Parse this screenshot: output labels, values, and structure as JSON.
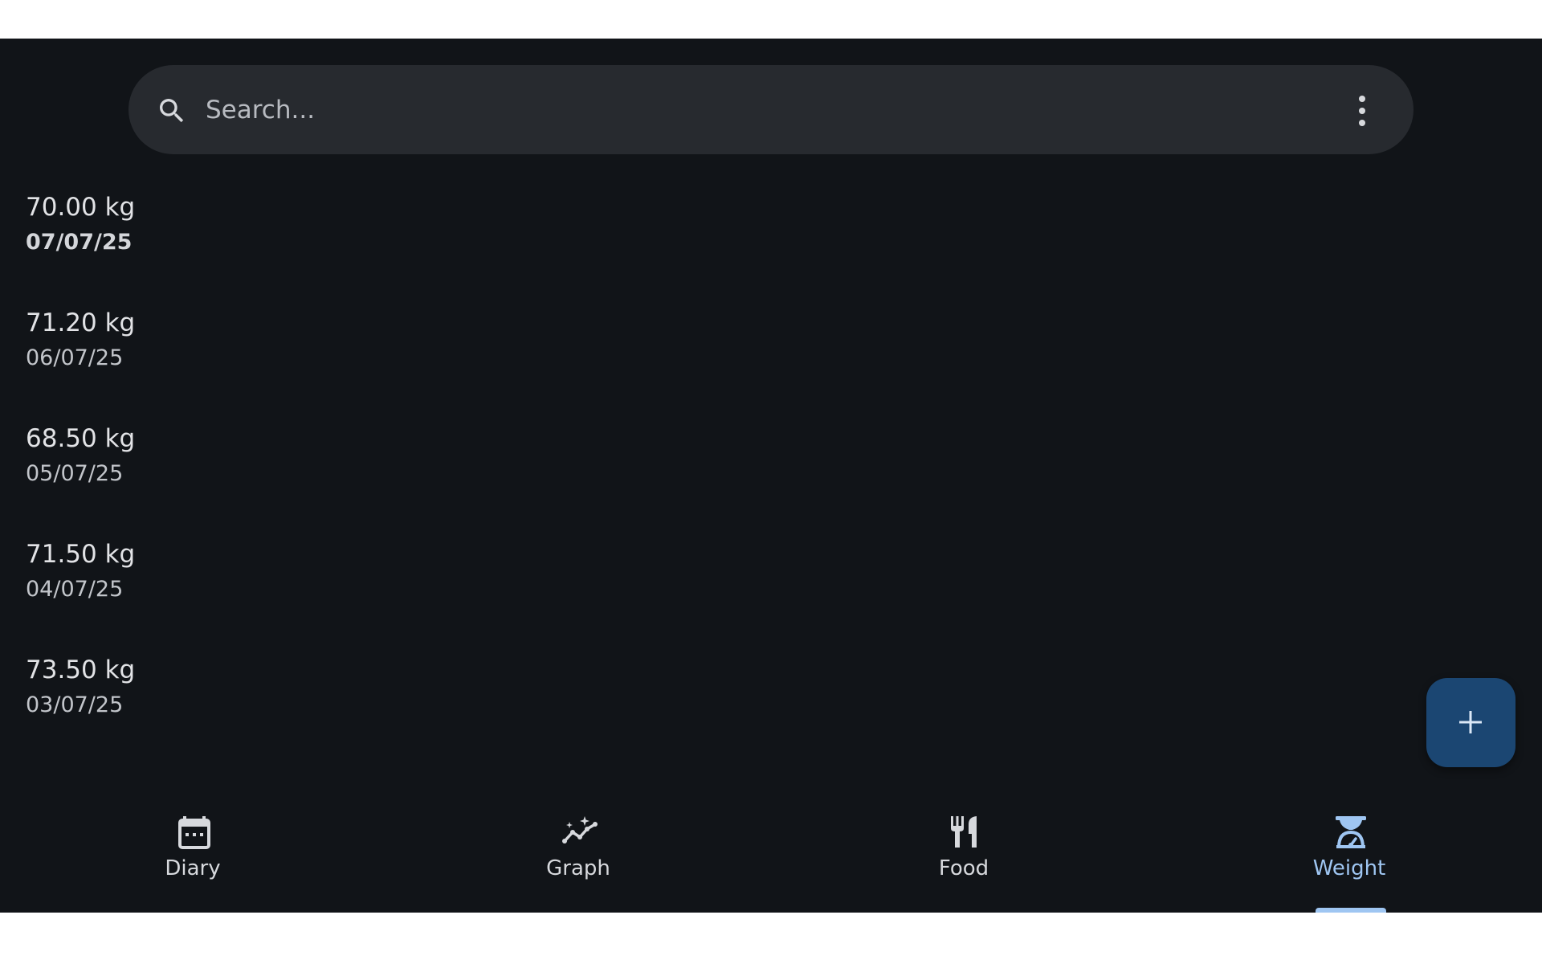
{
  "search": {
    "placeholder": "Search..."
  },
  "entries": [
    {
      "weight": "70.00 kg",
      "date": "07/07/25"
    },
    {
      "weight": "71.20 kg",
      "date": "06/07/25"
    },
    {
      "weight": "68.50 kg",
      "date": "05/07/25"
    },
    {
      "weight": "71.50 kg",
      "date": "04/07/25"
    },
    {
      "weight": "73.50 kg",
      "date": "03/07/25"
    }
  ],
  "nav": {
    "items": [
      {
        "label": "Diary",
        "icon": "calendar-icon"
      },
      {
        "label": "Graph",
        "icon": "graph-icon"
      },
      {
        "label": "Food",
        "icon": "fork-knife-icon"
      },
      {
        "label": "Weight",
        "icon": "scale-icon"
      }
    ],
    "active": "Weight"
  },
  "colors": {
    "background": "#111418",
    "search_bar": "#272a2f",
    "fab": "#1b4672",
    "accent": "#9fc6f2"
  }
}
